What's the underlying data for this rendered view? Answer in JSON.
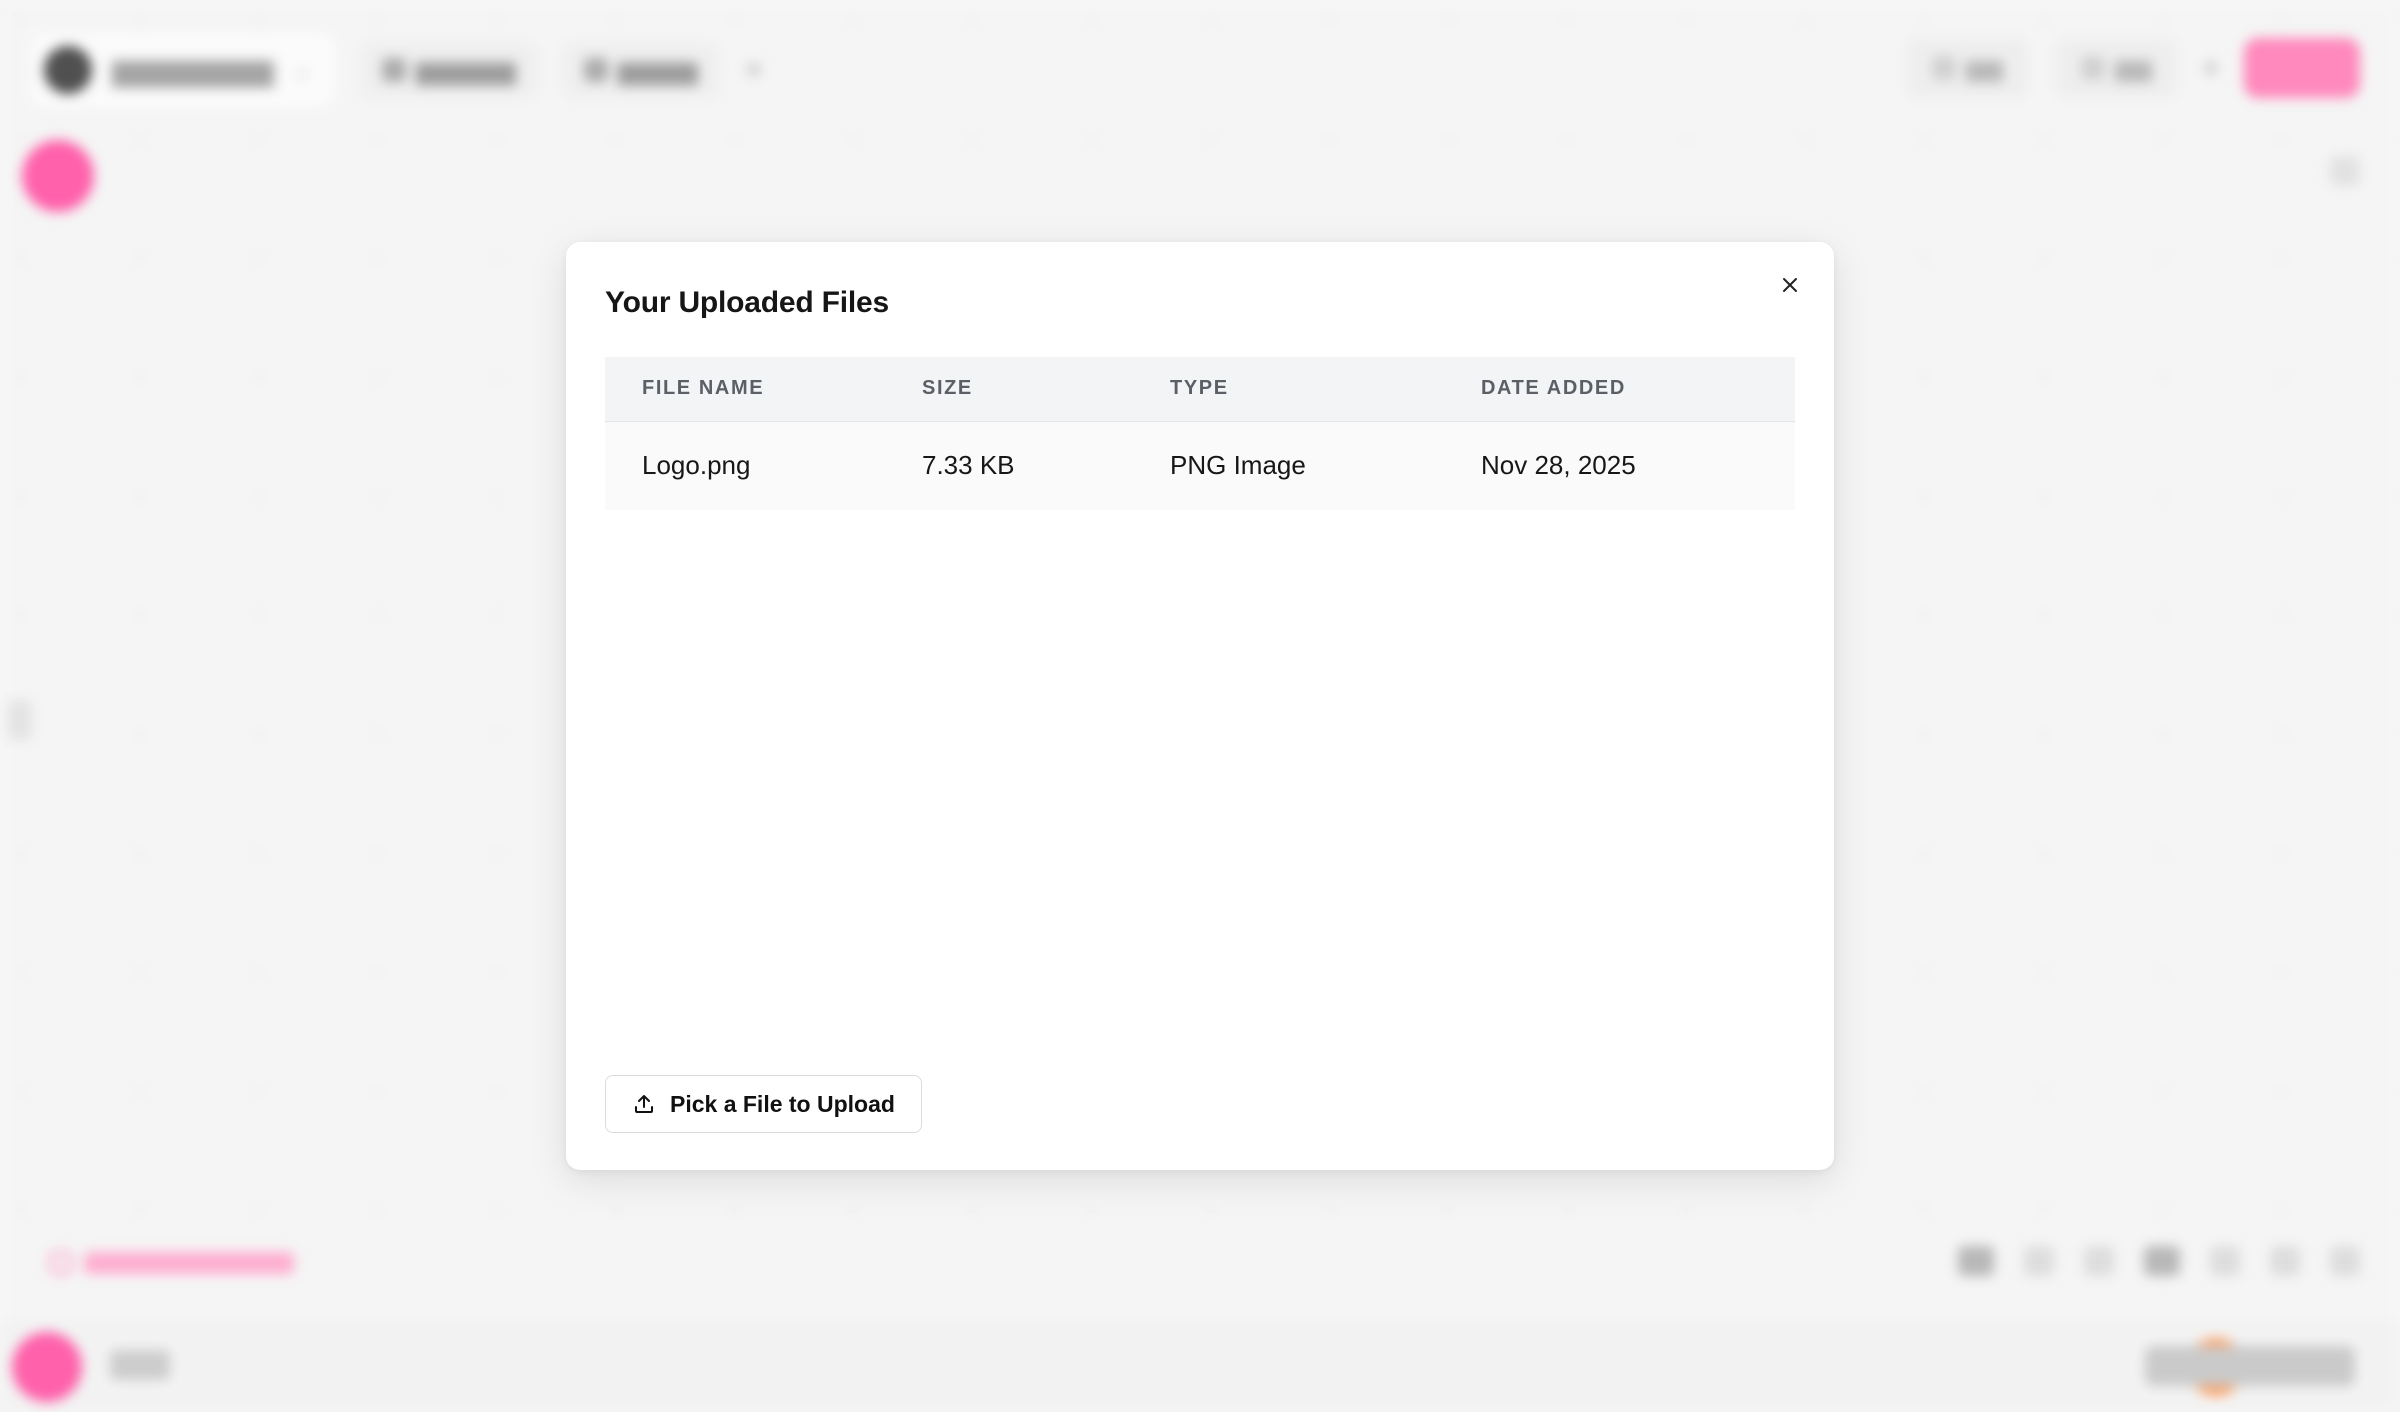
{
  "modal": {
    "title": "Your Uploaded Files",
    "close_icon": "close-icon",
    "table": {
      "columns": [
        "FILE NAME",
        "SIZE",
        "TYPE",
        "DATE ADDED"
      ],
      "rows": [
        {
          "file_name": "Logo.png",
          "size": "7.33 KB",
          "type": "PNG Image",
          "date_added": "Nov 28, 2025"
        }
      ]
    },
    "upload_button": {
      "label": "Pick a File to Upload",
      "icon": "upload-icon"
    }
  },
  "background": {
    "accent_color": "#ff3f99",
    "secondary_accent": "#ff8a3d"
  }
}
